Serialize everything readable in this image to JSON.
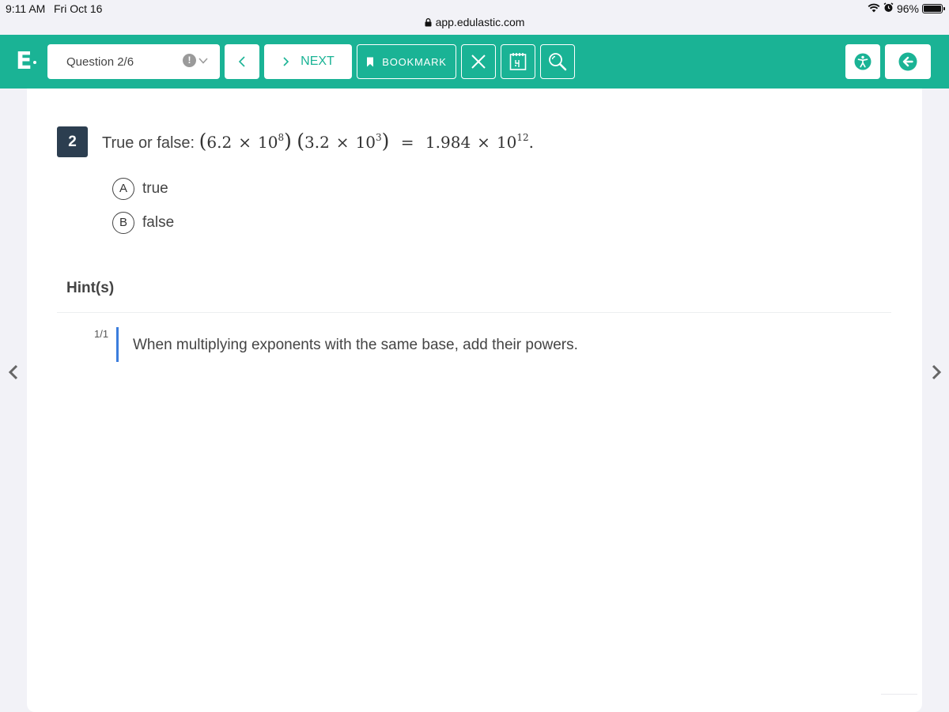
{
  "status_bar": {
    "time": "9:11 AM",
    "date": "Fri Oct 16",
    "battery": "96%",
    "icons": [
      "wifi-icon",
      "alarm-icon",
      "battery-icon"
    ]
  },
  "url": "app.edulastic.com",
  "toolbar": {
    "logo": "E",
    "question_select": "Question 2/6",
    "next_label": "NEXT",
    "bookmark_label": "BOOKMARK",
    "accent_color": "#1ab395"
  },
  "question": {
    "number": "2",
    "prompt": "True or false:",
    "math": {
      "a": "6.2",
      "a_exp": "8",
      "b": "3.2",
      "b_exp": "3",
      "result": "1.984",
      "result_exp": "12",
      "times": "×",
      "base": "10",
      "equals": "="
    },
    "choices": [
      {
        "letter": "A",
        "text": "true"
      },
      {
        "letter": "B",
        "text": "false"
      }
    ]
  },
  "hints": {
    "title": "Hint(s)",
    "count": "1/1",
    "text": "When multiplying exponents with the same base, add their powers."
  }
}
